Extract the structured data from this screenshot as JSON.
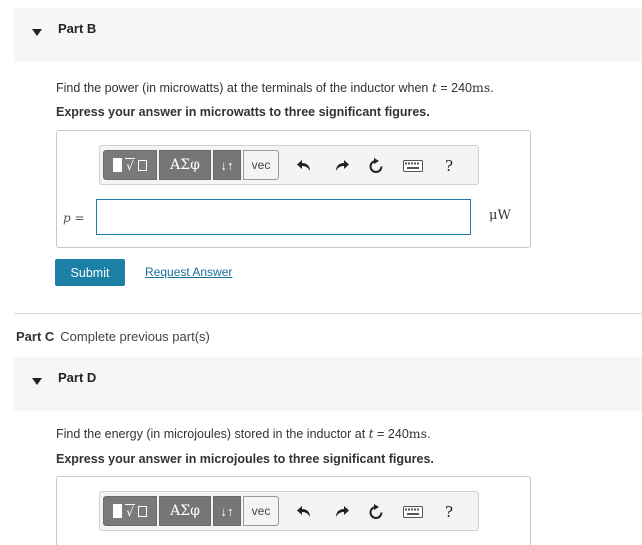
{
  "part_b": {
    "title": "Part B",
    "question_prefix": "Find the power (in microwatts) at the terminals of the inductor when ",
    "question_var": "t",
    "question_eq": " = 240",
    "question_unit": "ms",
    "question_suffix": ".",
    "instruction": "Express your answer in microwatts to three significant figures.",
    "input_label": "p =",
    "input_value": "",
    "units": "μW",
    "submit_label": "Submit",
    "request_answer_label": "Request Answer"
  },
  "toolbar": {
    "template_radical": "√",
    "greek_label": "ΑΣφ",
    "arrows_label": "↓↑",
    "vec_label": "vec",
    "icons": [
      "undo-icon",
      "redo-icon",
      "reset-icon",
      "keyboard-icon",
      "help-icon"
    ],
    "help_label": "?"
  },
  "part_c": {
    "title": "Part C",
    "status": "Complete previous part(s)"
  },
  "part_d": {
    "title": "Part D",
    "question_prefix": "Find the energy (in microjoules) stored in the inductor at ",
    "question_var": "t",
    "question_eq": " = 240",
    "question_unit": "ms",
    "question_suffix": ".",
    "instruction": "Express your answer in microjoules to three significant figures."
  }
}
